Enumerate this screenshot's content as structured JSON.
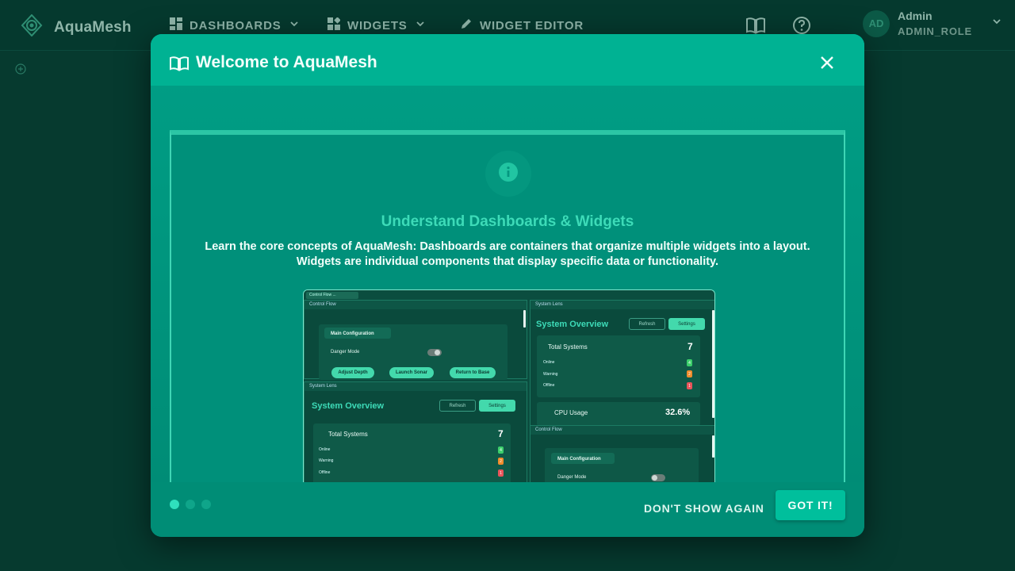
{
  "app": {
    "name": "AquaMesh"
  },
  "nav": [
    {
      "label": "DASHBOARDS",
      "icon": "dashboard-icon",
      "dropdown": true
    },
    {
      "label": "WIDGETS",
      "icon": "widgets-icon",
      "dropdown": true
    },
    {
      "label": "WIDGET EDITOR",
      "icon": "pencil-icon",
      "dropdown": false
    }
  ],
  "user": {
    "initials": "AD",
    "name": "Admin",
    "role": "ADMIN_ROLE"
  },
  "modal": {
    "title": "Welcome to AquaMesh",
    "step_title": "Understand Dashboards & Widgets",
    "step_description": "Learn the core concepts of AquaMesh: Dashboards are containers that organize multiple widgets into a layout. Widgets are individual components that display specific data or functionality.",
    "steps_total": 3,
    "step_active": 1,
    "dont_show_label": "DON'T SHOW AGAIN",
    "got_it_label": "GOT IT!"
  },
  "preview": {
    "tab_label": "Control Flow ...",
    "control_flow": {
      "title": "Control Flow",
      "section": "Main Configuration",
      "danger_mode": "Danger Mode",
      "buttons": [
        "Adjust Depth",
        "Launch Sonar",
        "Return to Base"
      ]
    },
    "system_lens": {
      "panel_title": "System Lens",
      "heading": "System Overview",
      "refresh": "Refresh",
      "settings": "Settings",
      "total_label": "Total Systems",
      "total_value": "7",
      "rows": [
        {
          "label": "Online",
          "value": "4",
          "color": "#3ccf6b"
        },
        {
          "label": "Warning",
          "value": "2",
          "color": "#f08c2c"
        },
        {
          "label": "Offline",
          "value": "1",
          "color": "#e8545a"
        }
      ],
      "cpu_label": "CPU Usage",
      "cpu_value": "32.6%"
    }
  },
  "colors": {
    "accent": "#00b293",
    "background": "#063a2f",
    "button": "#00bf9c"
  }
}
